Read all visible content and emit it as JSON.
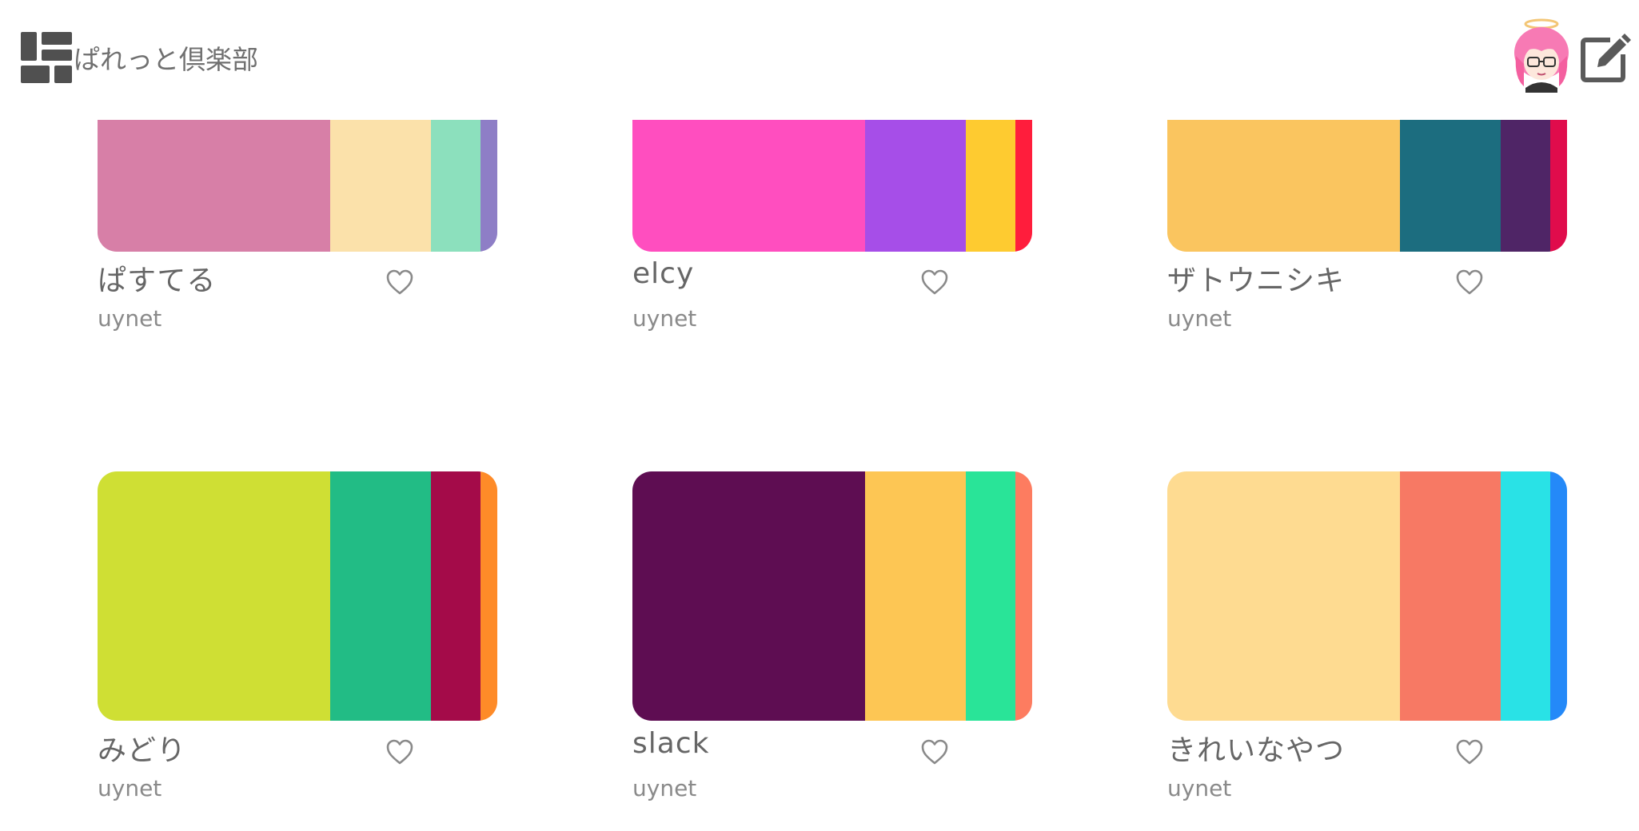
{
  "header": {
    "app_title": "ぱれっと倶楽部",
    "logo_icon": "blocks-logo-icon",
    "avatar_icon": "user-avatar",
    "edit_icon": "edit-icon"
  },
  "palettes": [
    {
      "title": "ぱすてる",
      "author": "uynet",
      "colors": [
        "#d77fa7",
        "#fbe1aa",
        "#8ce0bd",
        "#8e7ec6"
      ]
    },
    {
      "title": "elcy",
      "author": "uynet",
      "colors": [
        "#ff4ebf",
        "#a64ee8",
        "#fecb30",
        "#ff1d3c"
      ]
    },
    {
      "title": "ザトウニシキ",
      "author": "uynet",
      "colors": [
        "#fac55f",
        "#1c6d7f",
        "#4f2566",
        "#e00c4c"
      ]
    },
    {
      "title": "みどり",
      "author": "uynet",
      "colors": [
        "#cfdf34",
        "#22bc85",
        "#a40b49",
        "#fe8b28"
      ]
    },
    {
      "title": "slack",
      "author": "uynet",
      "colors": [
        "#5e0d52",
        "#fdc654",
        "#29e498",
        "#fd7c60"
      ]
    },
    {
      "title": "きれいなやつ",
      "author": "uynet",
      "colors": [
        "#fedb91",
        "#f77964",
        "#29e2e6",
        "#2489f8"
      ]
    }
  ],
  "like_icon": "heart-outline-icon"
}
